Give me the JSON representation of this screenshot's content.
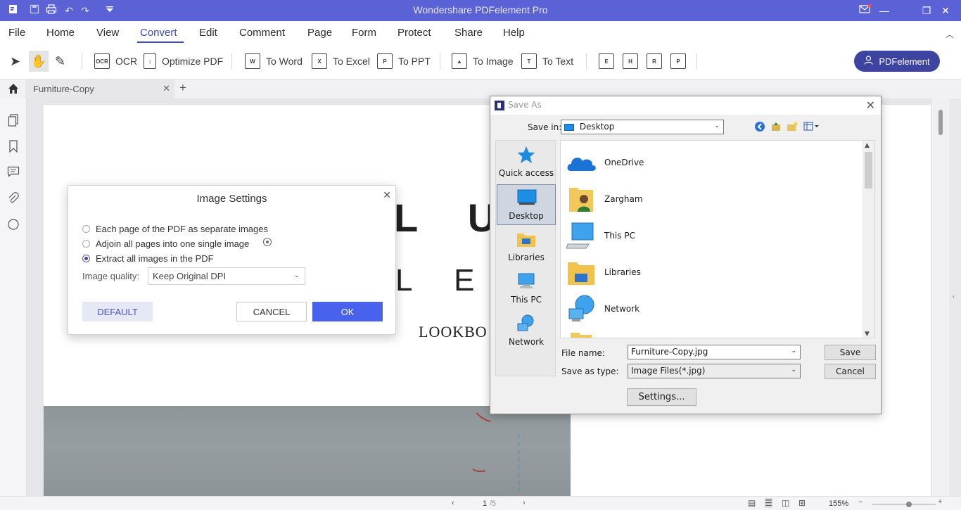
{
  "app": {
    "title": "Wondershare PDFelement Pro"
  },
  "menu": [
    "File",
    "Home",
    "View",
    "Convert",
    "Edit",
    "Comment",
    "Page",
    "Form",
    "Protect",
    "Share",
    "Help"
  ],
  "toolbar": {
    "ocr": "OCR",
    "optimize": "Optimize PDF",
    "to_word": "To Word",
    "to_excel": "To Excel",
    "to_ppt": "To PPT",
    "to_image": "To Image",
    "to_text": "To Text",
    "badge_e": "E",
    "badge_h": "H",
    "badge_r": "R",
    "badge_p": "P",
    "account": "PDFelement"
  },
  "tab": {
    "name": "Furniture-Copy",
    "add": "+"
  },
  "page": {
    "letters_row1": "L U",
    "letters_row2": "L E",
    "lookbook": "LOOKBO"
  },
  "image_settings": {
    "title": "Image Settings",
    "options": [
      {
        "label": "Each page of the PDF as separate images",
        "selected": false
      },
      {
        "label": "Adjoin all pages into one single image",
        "selected": false
      },
      {
        "label": "Extract all images in the PDF",
        "selected": true
      }
    ],
    "quality_label": "Image quality:",
    "quality_value": "Keep Original DPI",
    "default_btn": "DEFAULT",
    "cancel_btn": "CANCEL",
    "ok_btn": "OK"
  },
  "save_as": {
    "title": "Save As",
    "save_in_label": "Save in:",
    "save_in_value": "Desktop",
    "places": [
      "Quick access",
      "Desktop",
      "Libraries",
      "This PC",
      "Network"
    ],
    "files": [
      "OneDrive",
      "Zargham",
      "This PC",
      "Libraries",
      "Network"
    ],
    "file_name_label": "File name:",
    "file_name_value": "Furniture-Copy.jpg",
    "save_type_label": "Save as type:",
    "save_type_value": "Image Files(*.jpg)",
    "save_btn": "Save",
    "cancel_btn": "Cancel",
    "settings_btn": "Settings..."
  },
  "status": {
    "page_current": "1",
    "page_total": "/5",
    "zoom": "155%"
  },
  "colors": {
    "titlebar": "#5b62d6",
    "accent": "#3e46c8",
    "ok_button": "#4862ee",
    "account_button": "#3d449f"
  }
}
